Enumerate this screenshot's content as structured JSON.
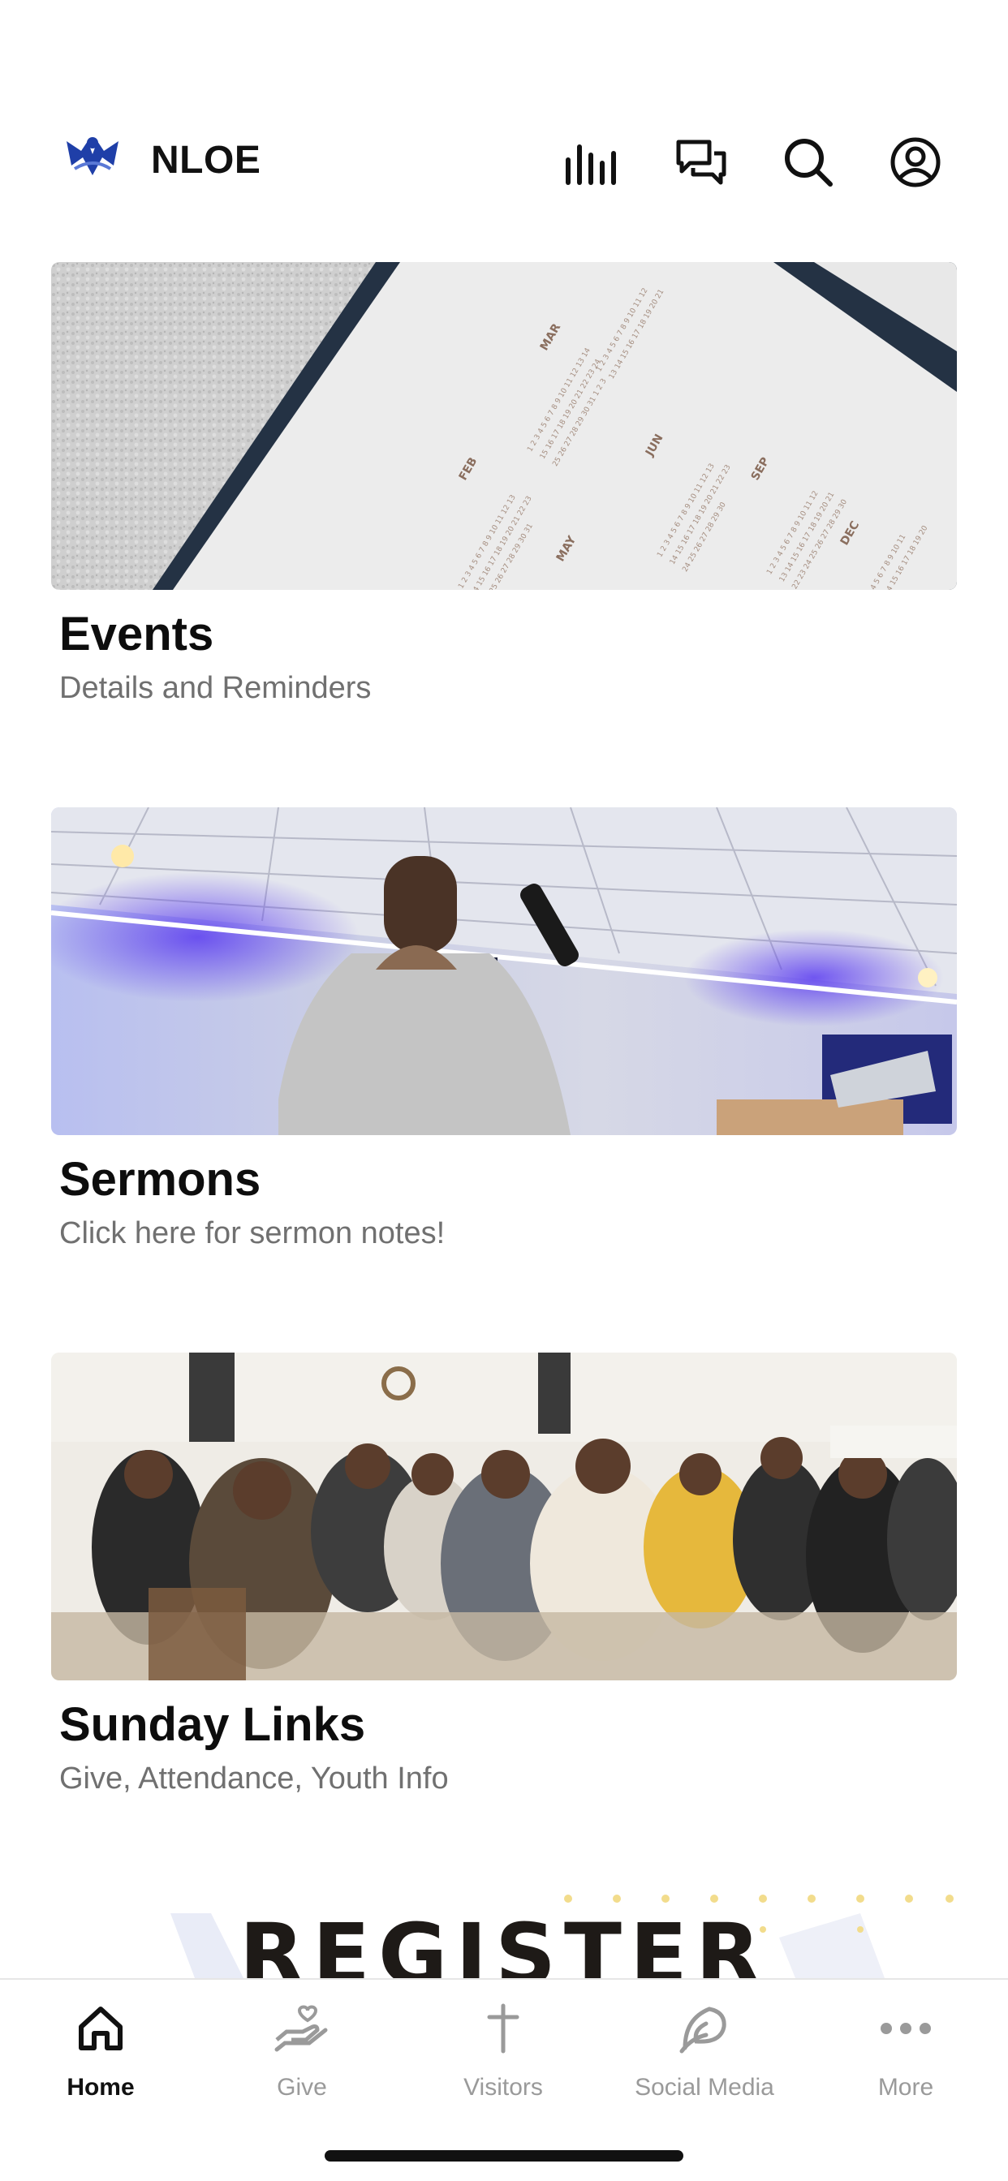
{
  "header": {
    "title": "NLOE",
    "icons": [
      "nloe-logo",
      "audio-bars-icon",
      "chat-icon",
      "search-icon",
      "account-icon"
    ]
  },
  "cards": [
    {
      "title": "Events",
      "subtitle": "Details and Reminders",
      "image": "calendar-photo",
      "months": [
        "MAR",
        "FEB",
        "JUN",
        "MAY",
        "SEP",
        "DEC"
      ]
    },
    {
      "title": "Sermons",
      "subtitle": "Click here for sermon notes!",
      "image": "preacher-photo"
    },
    {
      "title": "Sunday Links",
      "subtitle": "Give, Attendance, Youth Info",
      "image": "congregation-photo"
    }
  ],
  "banner": {
    "text": "REGISTER"
  },
  "tabbar": {
    "items": [
      {
        "label": "Home",
        "icon": "home-icon",
        "active": true
      },
      {
        "label": "Give",
        "icon": "give-heart-hand-icon",
        "active": false
      },
      {
        "label": "Visitors",
        "icon": "cross-icon",
        "active": false
      },
      {
        "label": "Social Media",
        "icon": "social-leaf-icon",
        "active": false
      },
      {
        "label": "More",
        "icon": "more-dots-icon",
        "active": false
      }
    ]
  },
  "colors": {
    "brand": "#1f3fa8",
    "active_tab": "#111111",
    "inactive_tab": "#9a9a9a",
    "subtitle": "#707070"
  }
}
